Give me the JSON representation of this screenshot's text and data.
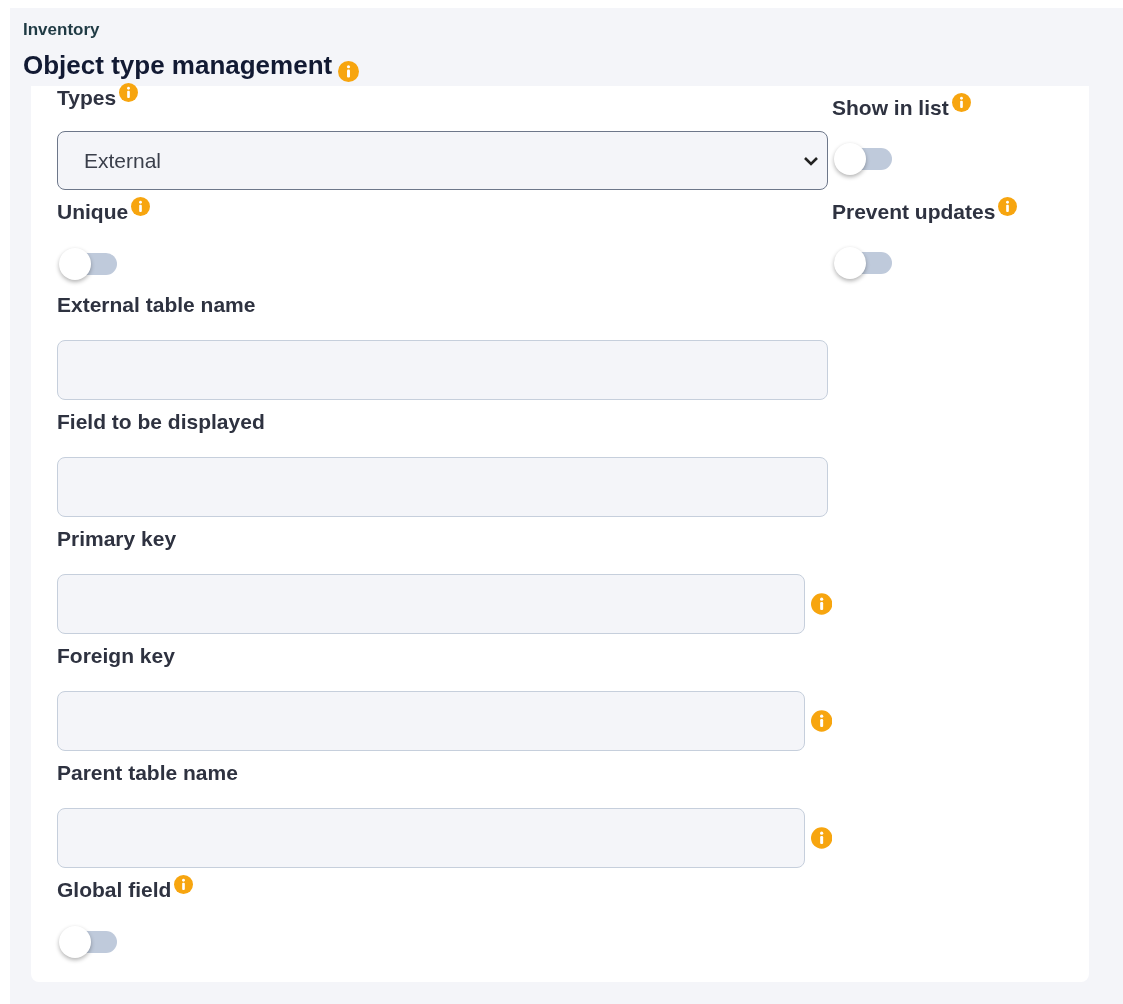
{
  "breadcrumb": "Inventory",
  "title": "Object type management",
  "fields": [
    {
      "kind": "select",
      "label": "Types",
      "label_info": true,
      "value": "External"
    },
    {
      "kind": "toggle",
      "label": "Unique",
      "label_info": true,
      "on": false
    },
    {
      "kind": "text",
      "label": "External table name",
      "label_info": false,
      "input_info": false
    },
    {
      "kind": "text",
      "label": "Field to be displayed",
      "label_info": false,
      "input_info": false
    },
    {
      "kind": "text",
      "label": "Primary key",
      "label_info": false,
      "input_info": true
    },
    {
      "kind": "text",
      "label": "Foreign key",
      "label_info": false,
      "input_info": true
    },
    {
      "kind": "text",
      "label": "Parent table name",
      "label_info": false,
      "input_info": true
    },
    {
      "kind": "toggle",
      "label": "Global field",
      "label_info": true,
      "on": false
    }
  ],
  "side_fields": [
    {
      "kind": "toggle",
      "label": "Show in list",
      "label_info": true,
      "on": false
    },
    {
      "kind": "toggle",
      "label": "Prevent updates",
      "label_info": true,
      "on": false
    }
  ]
}
